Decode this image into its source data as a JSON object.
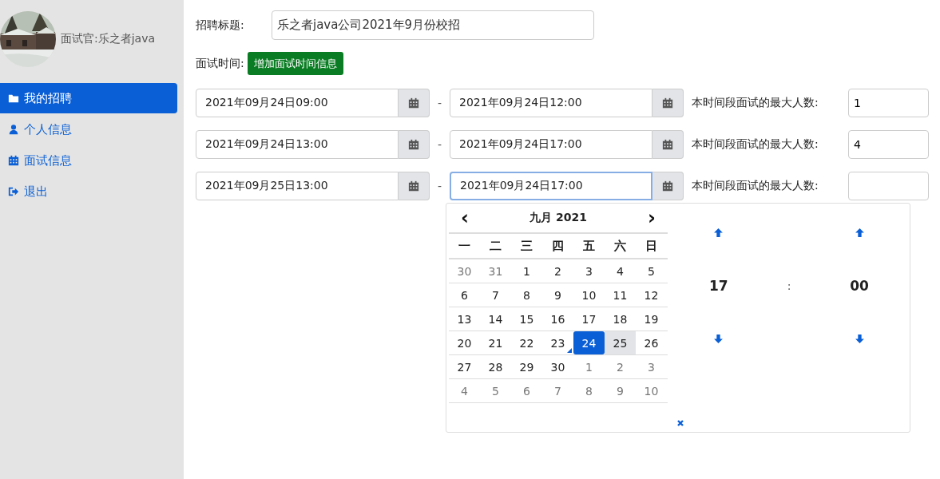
{
  "sidebar": {
    "user": "面试官:乐之者java",
    "items": [
      {
        "label": "我的招聘",
        "kind": "folder",
        "selected": true
      },
      {
        "label": "个人信息",
        "kind": "user",
        "selected": false
      },
      {
        "label": "面试信息",
        "kind": "calendar",
        "selected": false
      },
      {
        "label": "退出",
        "kind": "signout",
        "selected": false
      }
    ]
  },
  "form": {
    "title_label": "招聘标题:",
    "title_value": "乐之者java公司2021年9月份校招",
    "time_label": "面试时间:",
    "add_button": "增加面试时间信息",
    "slots": [
      {
        "start": "2021年09月24日09:00",
        "separator": "-",
        "end": "2021年09月24日12:00",
        "max_label": "本时间段面试的最大人数:",
        "max": "1",
        "focused": false
      },
      {
        "start": "2021年09月24日13:00",
        "separator": "-",
        "end": "2021年09月24日17:00",
        "max_label": "本时间段面试的最大人数:",
        "max": "4",
        "focused": false
      },
      {
        "start": "2021年09月25日13:00",
        "separator": "-",
        "end": "2021年09月24日17:00",
        "max_label": "本时间段面试的最大人数:",
        "focused": true
      }
    ]
  },
  "picker": {
    "prev": "‹",
    "next": "›",
    "month": "九月 2021",
    "weekdays": [
      "一",
      "二",
      "三",
      "四",
      "五",
      "六",
      "日"
    ],
    "weeks": [
      [
        {
          "d": "30",
          "kind": "other",
          "selected": false,
          "hovered": false,
          "today": false
        },
        {
          "d": "31",
          "kind": "other",
          "selected": false,
          "hovered": false,
          "today": false
        },
        {
          "d": "1",
          "kind": "current",
          "selected": false,
          "hovered": false,
          "today": false
        },
        {
          "d": "2",
          "kind": "current",
          "selected": false,
          "hovered": false,
          "today": false
        },
        {
          "d": "3",
          "kind": "current",
          "selected": false,
          "hovered": false,
          "today": false
        },
        {
          "d": "4",
          "kind": "current",
          "selected": false,
          "hovered": false,
          "today": false
        },
        {
          "d": "5",
          "kind": "current",
          "selected": false,
          "hovered": false,
          "today": false
        }
      ],
      [
        {
          "d": "6",
          "kind": "current",
          "selected": false,
          "hovered": false,
          "today": false
        },
        {
          "d": "7",
          "kind": "current",
          "selected": false,
          "hovered": false,
          "today": false
        },
        {
          "d": "8",
          "kind": "current",
          "selected": false,
          "hovered": false,
          "today": false
        },
        {
          "d": "9",
          "kind": "current",
          "selected": false,
          "hovered": false,
          "today": false
        },
        {
          "d": "10",
          "kind": "current",
          "selected": false,
          "hovered": false,
          "today": false
        },
        {
          "d": "11",
          "kind": "current",
          "selected": false,
          "hovered": false,
          "today": false
        },
        {
          "d": "12",
          "kind": "current",
          "selected": false,
          "hovered": false,
          "today": false
        }
      ],
      [
        {
          "d": "13",
          "kind": "current",
          "selected": false,
          "hovered": false,
          "today": false
        },
        {
          "d": "14",
          "kind": "current",
          "selected": false,
          "hovered": false,
          "today": false
        },
        {
          "d": "15",
          "kind": "current",
          "selected": false,
          "hovered": false,
          "today": false
        },
        {
          "d": "16",
          "kind": "current",
          "selected": false,
          "hovered": false,
          "today": false
        },
        {
          "d": "17",
          "kind": "current",
          "selected": false,
          "hovered": false,
          "today": false
        },
        {
          "d": "18",
          "kind": "current",
          "selected": false,
          "hovered": false,
          "today": false
        },
        {
          "d": "19",
          "kind": "current",
          "selected": false,
          "hovered": false,
          "today": false
        }
      ],
      [
        {
          "d": "20",
          "kind": "current",
          "selected": false,
          "hovered": false,
          "today": false
        },
        {
          "d": "21",
          "kind": "current",
          "selected": false,
          "hovered": false,
          "today": false
        },
        {
          "d": "22",
          "kind": "current",
          "selected": false,
          "hovered": false,
          "today": false
        },
        {
          "d": "23",
          "kind": "current",
          "selected": false,
          "hovered": false,
          "today": true
        },
        {
          "d": "24",
          "kind": "current",
          "selected": true,
          "hovered": false,
          "today": false
        },
        {
          "d": "25",
          "kind": "current",
          "selected": false,
          "hovered": true,
          "today": false
        },
        {
          "d": "26",
          "kind": "current",
          "selected": false,
          "hovered": false,
          "today": false
        }
      ],
      [
        {
          "d": "27",
          "kind": "current",
          "selected": false,
          "hovered": false,
          "today": false
        },
        {
          "d": "28",
          "kind": "current",
          "selected": false,
          "hovered": false,
          "today": false
        },
        {
          "d": "29",
          "kind": "current",
          "selected": false,
          "hovered": false,
          "today": false
        },
        {
          "d": "30",
          "kind": "current",
          "selected": false,
          "hovered": false,
          "today": false
        },
        {
          "d": "1",
          "kind": "other",
          "selected": false,
          "hovered": false,
          "today": false
        },
        {
          "d": "2",
          "kind": "other",
          "selected": false,
          "hovered": false,
          "today": false
        },
        {
          "d": "3",
          "kind": "other",
          "selected": false,
          "hovered": false,
          "today": false
        }
      ],
      [
        {
          "d": "4",
          "kind": "other",
          "selected": false,
          "hovered": false,
          "today": false
        },
        {
          "d": "5",
          "kind": "other",
          "selected": false,
          "hovered": false,
          "today": false
        },
        {
          "d": "6",
          "kind": "other",
          "selected": false,
          "hovered": false,
          "today": false
        },
        {
          "d": "7",
          "kind": "other",
          "selected": false,
          "hovered": false,
          "today": false
        },
        {
          "d": "8",
          "kind": "other",
          "selected": false,
          "hovered": false,
          "today": false
        },
        {
          "d": "9",
          "kind": "other",
          "selected": false,
          "hovered": false,
          "today": false
        },
        {
          "d": "10",
          "kind": "other",
          "selected": false,
          "hovered": false,
          "today": false
        }
      ]
    ],
    "hour": "17",
    "colon": ":",
    "minute": "00"
  }
}
